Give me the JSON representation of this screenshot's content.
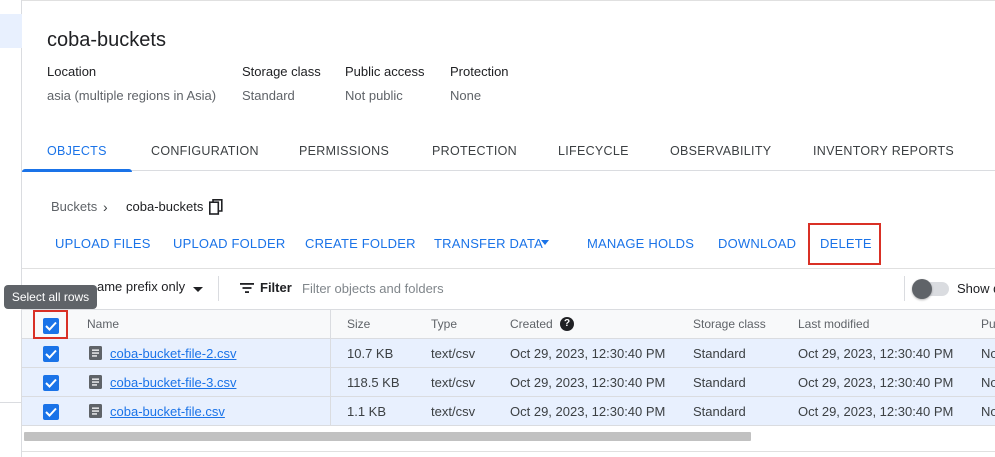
{
  "bucket": {
    "title": "coba-buckets",
    "meta": [
      {
        "label": "Location",
        "value": "asia (multiple regions in Asia)"
      },
      {
        "label": "Storage class",
        "value": "Standard"
      },
      {
        "label": "Public access",
        "value": "Not public"
      },
      {
        "label": "Protection",
        "value": "None"
      }
    ]
  },
  "tabs": [
    "OBJECTS",
    "CONFIGURATION",
    "PERMISSIONS",
    "PROTECTION",
    "LIFECYCLE",
    "OBSERVABILITY",
    "INVENTORY REPORTS"
  ],
  "active_tab": "OBJECTS",
  "breadcrumb": {
    "parent": "Buckets",
    "separator": "›",
    "current": "coba-buckets"
  },
  "actions": {
    "upload_files": "UPLOAD FILES",
    "upload_folder": "UPLOAD FOLDER",
    "create_folder": "CREATE FOLDER",
    "transfer_data": "TRANSFER DATA",
    "manage_holds": "MANAGE HOLDS",
    "download": "DOWNLOAD",
    "delete": "DELETE"
  },
  "filter": {
    "mode": "ame prefix only",
    "label": "Filter",
    "placeholder": "Filter objects and folders",
    "show_label": "Show d"
  },
  "tooltip": "Select all rows",
  "table": {
    "headers": {
      "name": "Name",
      "size": "Size",
      "type": "Type",
      "created": "Created",
      "storage_class": "Storage class",
      "last_modified": "Last modified",
      "public": "Pu"
    },
    "rows": [
      {
        "name": "coba-bucket-file-2.csv",
        "size": "10.7 KB",
        "type": "text/csv",
        "created": "Oct 29, 2023, 12:30:40 PM",
        "storage_class": "Standard",
        "last_modified": "Oct 29, 2023, 12:30:40 PM",
        "public": "No"
      },
      {
        "name": "coba-bucket-file-3.csv",
        "size": "118.5 KB",
        "type": "text/csv",
        "created": "Oct 29, 2023, 12:30:40 PM",
        "storage_class": "Standard",
        "last_modified": "Oct 29, 2023, 12:30:40 PM",
        "public": "No"
      },
      {
        "name": "coba-bucket-file.csv",
        "size": "1.1 KB",
        "type": "text/csv",
        "created": "Oct 29, 2023, 12:30:40 PM",
        "storage_class": "Standard",
        "last_modified": "Oct 29, 2023, 12:30:40 PM",
        "public": "No"
      }
    ]
  },
  "colors": {
    "accent": "#1a73e8",
    "highlight": "#d93025",
    "selected_row": "#e8f0fe"
  }
}
